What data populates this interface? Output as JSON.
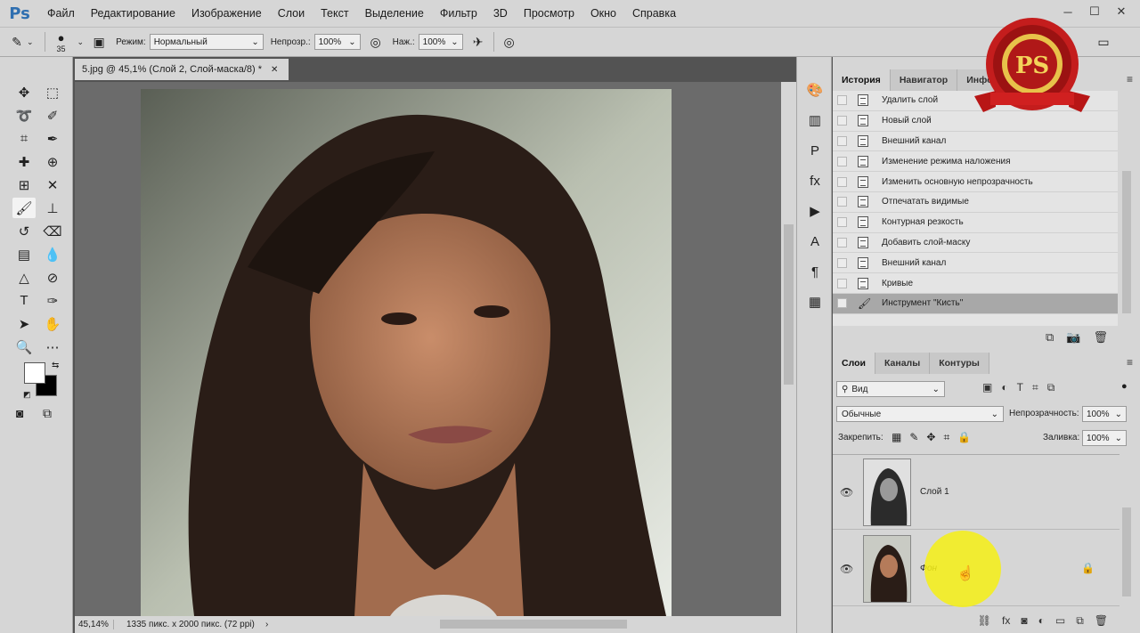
{
  "app": {
    "logo": "Ps"
  },
  "menu": [
    "Файл",
    "Редактирование",
    "Изображение",
    "Слои",
    "Текст",
    "Выделение",
    "Фильтр",
    "3D",
    "Просмотр",
    "Окно",
    "Справка"
  ],
  "options": {
    "brush_size": "35",
    "mode_label": "Режим:",
    "mode_value": "Нормальный",
    "opacity_label": "Непрозр.:",
    "opacity_value": "100%",
    "pressure_label": "Наж.:",
    "pressure_value": "100%"
  },
  "document": {
    "tab_title": "5.jpg @ 45,1% (Слой 2, Слой-маска/8) *",
    "zoom": "45,14%",
    "info": "1335 пикс. x 2000 пикс. (72 ppi)"
  },
  "colors": {
    "foreground": "#ffffff",
    "background": "#000000",
    "highlight": "#f6f014"
  },
  "history": {
    "tabs": [
      "История",
      "Навигатор",
      "Инфо"
    ],
    "items": [
      {
        "label": "Удалить слой",
        "icon": "document-icon"
      },
      {
        "label": "Новый слой",
        "icon": "document-icon"
      },
      {
        "label": "Внешний канал",
        "icon": "document-icon"
      },
      {
        "label": "Изменение режима наложения",
        "icon": "document-icon"
      },
      {
        "label": "Изменить основную непрозрачность",
        "icon": "document-icon"
      },
      {
        "label": "Отпечатать видимые",
        "icon": "document-icon"
      },
      {
        "label": "Контурная резкость",
        "icon": "document-icon"
      },
      {
        "label": "Добавить слой-маску",
        "icon": "document-icon"
      },
      {
        "label": "Внешний канал",
        "icon": "document-icon"
      },
      {
        "label": "Кривые",
        "icon": "document-icon"
      },
      {
        "label": "Инструмент \"Кисть\"",
        "icon": "brush-icon"
      }
    ]
  },
  "layers": {
    "tabs": [
      "Слои",
      "Каналы",
      "Контуры"
    ],
    "filter_value": "Вид",
    "blend_mode": "Обычные",
    "opacity_label": "Непрозрачность:",
    "opacity_value": "100%",
    "lock_label": "Закрепить:",
    "fill_label": "Заливка:",
    "fill_value": "100%",
    "items": [
      {
        "name": "Слой 1"
      },
      {
        "name": "Фон"
      }
    ]
  },
  "badge": {
    "text": "PS"
  }
}
